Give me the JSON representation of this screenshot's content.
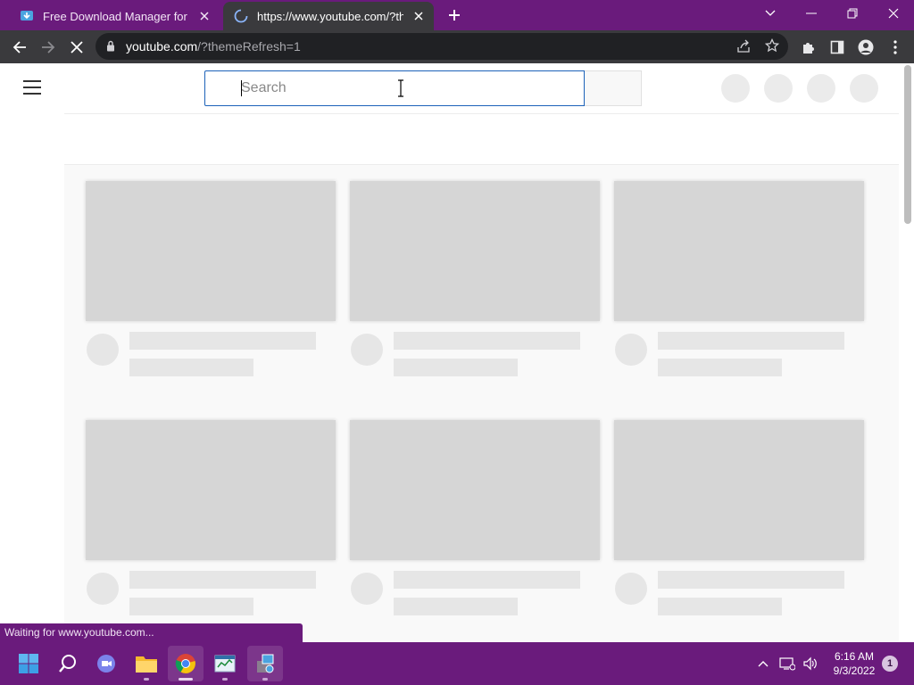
{
  "browser": {
    "tabs": [
      {
        "title": "Free Download Manager for Win",
        "icon": "fdm-icon",
        "active": false
      },
      {
        "title": "https://www.youtube.com/?them",
        "icon": "loading-spinner-icon",
        "active": true
      }
    ],
    "address": {
      "host": "youtube.com",
      "path": "/?themeRefresh=1"
    },
    "status_text": "Waiting for www.youtube.com..."
  },
  "page": {
    "search": {
      "placeholder": "Search",
      "value": ""
    }
  },
  "taskbar": {
    "apps": [
      "windows-start-icon",
      "search-icon",
      "teams-chat-icon",
      "file-explorer-icon",
      "chrome-icon",
      "task-manager-icon",
      "installer-icon"
    ],
    "clock": {
      "time": "6:16 AM",
      "date": "9/3/2022"
    },
    "notification_count": "1"
  },
  "colors": {
    "accent": "#6a1b7c",
    "toolbar": "#3a3a3d",
    "omnibox": "#202124",
    "search_border": "#1c62b9",
    "skeleton": "#d6d6d6"
  }
}
